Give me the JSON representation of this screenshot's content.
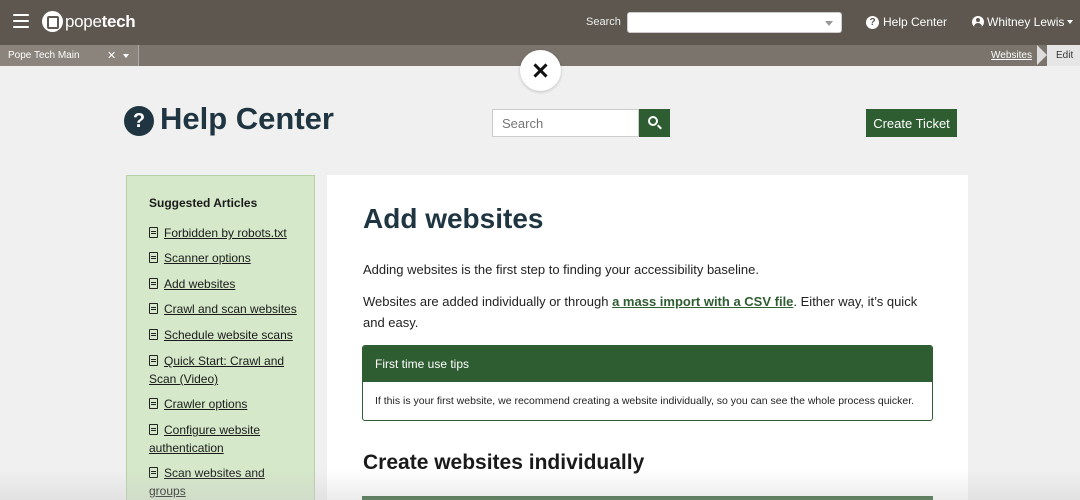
{
  "topbar": {
    "logo_text_light": "pope",
    "logo_text_bold": "tech",
    "search_label": "Search",
    "search_value": "",
    "help_label": "Help Center",
    "user_name": "Whitney Lewis"
  },
  "subbar": {
    "organization": "Pope Tech Main",
    "breadcrumb_link": "Websites",
    "breadcrumb_current": "Edit"
  },
  "help": {
    "title": "Help Center",
    "search_placeholder": "Search",
    "create_ticket": "Create Ticket"
  },
  "sidebar": {
    "heading": "Suggested Articles",
    "items": [
      {
        "label": "Forbidden by robots.txt"
      },
      {
        "label": "Scanner options"
      },
      {
        "label": "Add websites"
      },
      {
        "label": "Crawl and scan websites"
      },
      {
        "label": "Schedule website scans"
      },
      {
        "label": "Quick Start: Crawl and Scan (Video)"
      },
      {
        "label": "Crawler options"
      },
      {
        "label": "Configure website authentication"
      },
      {
        "label": "Scan websites and groups"
      }
    ]
  },
  "article": {
    "title": "Add websites",
    "intro": "Adding websites is the first step to finding your accessibility baseline.",
    "para2_before": "Websites are added individually or through ",
    "para2_link": "a mass import with a CSV file",
    "para2_after": ". Either way, it’s quick and easy.",
    "tips_title": "First time use tips",
    "tips_body": "If this is your first website, we recommend creating a website individually, so you can see the whole process quicker.",
    "section_title": "Create websites individually"
  },
  "colors": {
    "topbar": "#5d574f",
    "accent_green": "#2f5d32",
    "sidebar_bg": "#d5e8c9",
    "title_navy": "#1f3642"
  }
}
